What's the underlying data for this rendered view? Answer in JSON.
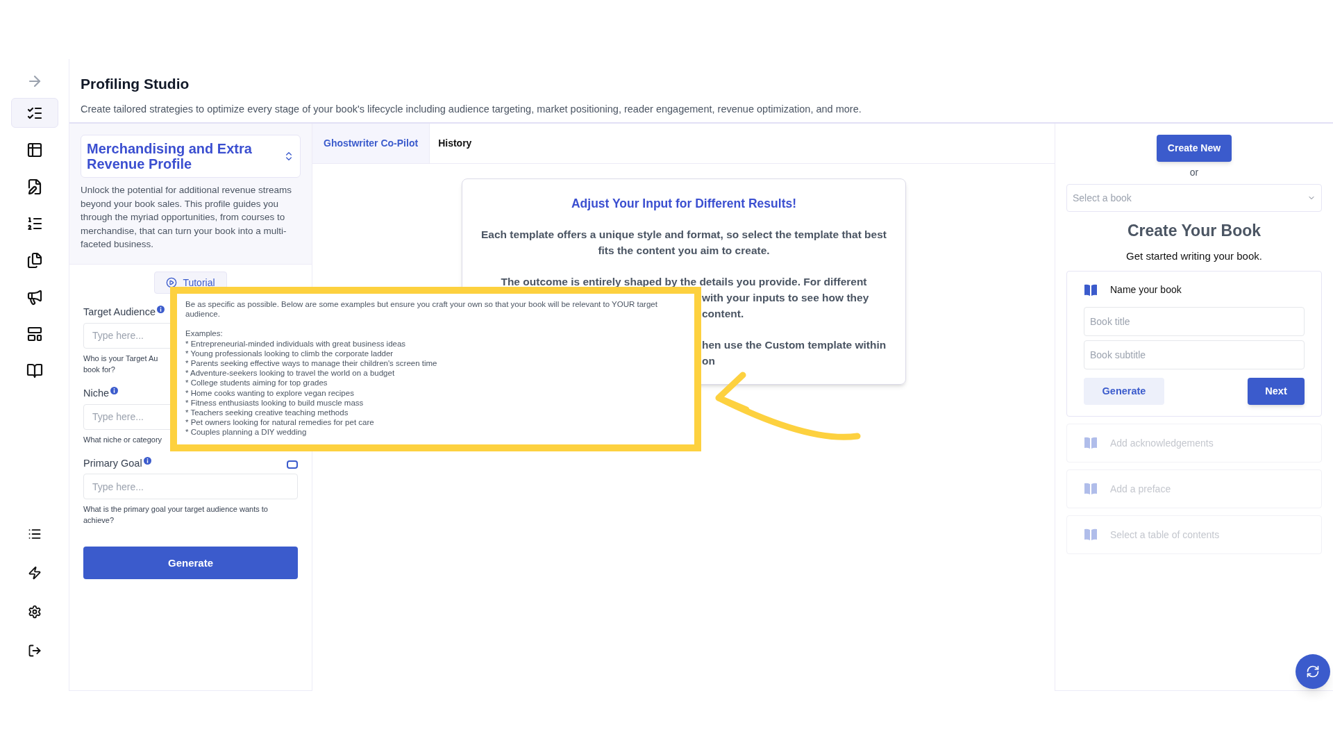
{
  "sidebar": {
    "top": [
      {
        "kind": "collapse"
      }
    ],
    "items": [
      {
        "kind": "profiles",
        "selected": true
      },
      {
        "kind": "outline",
        "selected": false
      },
      {
        "kind": "write",
        "selected": false
      },
      {
        "kind": "list",
        "selected": false
      },
      {
        "kind": "pages",
        "selected": false
      },
      {
        "kind": "promote",
        "selected": false
      },
      {
        "kind": "layout",
        "selected": false
      },
      {
        "kind": "book",
        "selected": false
      }
    ],
    "bottom": [
      {
        "kind": "menu"
      },
      {
        "kind": "bolt"
      },
      {
        "kind": "settings"
      },
      {
        "kind": "logout"
      }
    ]
  },
  "header": {
    "title": "Profiling Studio",
    "description": "Create tailored strategies to optimize every stage of your book's lifecycle including audience targeting, market positioning, reader engagement, revenue optimization, and more."
  },
  "profile": {
    "title": "Merchandising and Extra Revenue Profile",
    "description": "Unlock the potential for additional revenue streams beyond your book sales. This profile guides you through the myriad opportunities, from courses to merchandise, that can turn your book into a multi-faceted business."
  },
  "tutorial_button": "Tutorial",
  "fields": [
    {
      "label": "Target Audience",
      "placeholder": "Type here...",
      "help": [
        "Who is your Target Au",
        "book for?"
      ]
    },
    {
      "label": "Niche",
      "placeholder": "Type here...",
      "help": [
        "What niche or category"
      ]
    },
    {
      "label": "Primary Goal",
      "placeholder": "Type here...",
      "help": [
        "What is the primary goal your target audience wants to achieve?"
      ],
      "checkbox": {
        "checked": false
      }
    }
  ],
  "generate_button": "Generate",
  "tabs": [
    {
      "label": "Ghostwriter Co-Pilot",
      "selected": true
    },
    {
      "label": "History",
      "selected": false
    }
  ],
  "info_card": {
    "title": "Adjust Your Input for Different Results!",
    "paragraph": "Each template offers a unique style and format, so select the template that best fits the content you aim to create.",
    "line_1": "The outcome is entirely shaped by the details you provide. For different",
    "covered_lines": [
      {
        "text": "with your inputs to see how they",
        "gap": false
      },
      {
        "text": "content.",
        "gap": false
      },
      {
        "text": "hen use the **Custom** template within",
        "gap": true
      },
      {
        "text": "on",
        "gap": false
      }
    ]
  },
  "tooltip": {
    "intro": "Be as specific as possible. Below are some examples but ensure you craft your own so that your book will be relevant to YOUR target audience.",
    "examples_label": "Examples:",
    "examples": [
      "* Entrepreneurial-minded individuals with great business ideas",
      "* Young professionals looking to climb the corporate ladder",
      "* Parents seeking effective ways to manage their children's screen time",
      "* Adventure-seekers looking to travel the world on a budget",
      "* College students aiming for top grades",
      "* Home cooks wanting to explore vegan recipes",
      "* Fitness enthusiasts looking to build muscle mass",
      "* Teachers seeking creative teaching methods",
      "* Pet owners looking for natural remedies for pet care",
      "* Couples planning a DIY wedding"
    ]
  },
  "book_panel": {
    "create_new": "Create New",
    "or": "or",
    "select_placeholder": "Select a book",
    "title": "Create Your Book",
    "subtitle": "Get started writing your book.",
    "steps": [
      {
        "label": "Name your book",
        "disabled": false
      },
      {
        "label": "Add acknowledgements",
        "disabled": true
      },
      {
        "label": "Add a preface",
        "disabled": true
      },
      {
        "label": "Select a table of contents",
        "disabled": true
      }
    ],
    "title_placeholder": "Book title",
    "subtitle_placeholder": "Book subtitle",
    "generate": "Generate",
    "next": "Next"
  }
}
